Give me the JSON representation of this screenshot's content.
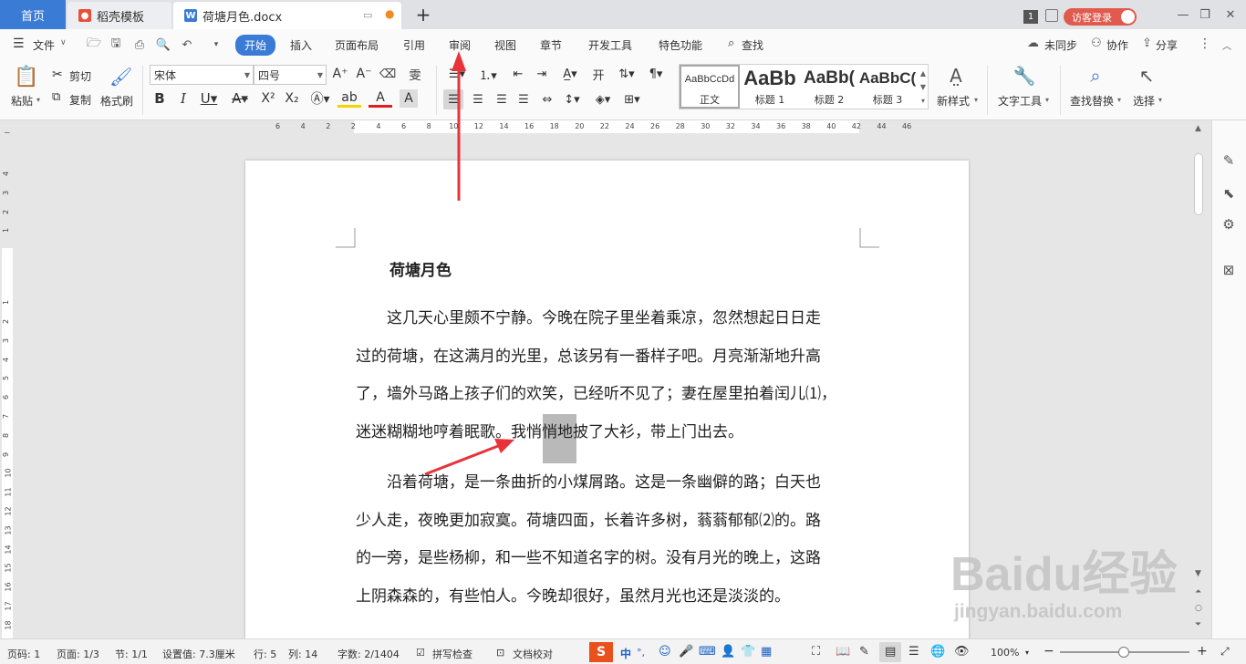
{
  "tabs": {
    "home": "首页",
    "template": "稻壳模板",
    "document": "荷塘月色.docx",
    "doc_icon": "W",
    "new_tab": "+"
  },
  "window": {
    "badge": "1",
    "login": "访客登录"
  },
  "menu": {
    "file": "文件",
    "items": [
      "开始",
      "插入",
      "页面布局",
      "引用",
      "审阅",
      "视图",
      "章节",
      "开发工具",
      "特色功能"
    ],
    "search": "查找",
    "sync": "未同步",
    "collab": "协作",
    "share": "分享"
  },
  "ribbon": {
    "paste": "粘贴",
    "cut": "剪切",
    "copy": "复制",
    "format_painter": "格式刷",
    "font_name": "宋体",
    "font_size": "四号",
    "styles": [
      {
        "sample": "AaBbCcDd",
        "name": "正文"
      },
      {
        "sample": "AaBb",
        "name": "标题 1"
      },
      {
        "sample": "AaBb(",
        "name": "标题 2"
      },
      {
        "sample": "AaBbC(",
        "name": "标题 3"
      }
    ],
    "new_style": "新样式",
    "text_tools": "文字工具",
    "find_replace": "查找替换",
    "select": "选择"
  },
  "ruler": {
    "h_marks": [
      "6",
      "4",
      "2",
      "2",
      "4",
      "6",
      "8",
      "10",
      "12",
      "14",
      "16",
      "18",
      "20",
      "22",
      "24",
      "26",
      "28",
      "30",
      "32",
      "34",
      "36",
      "38",
      "40",
      "42",
      "44",
      "46"
    ],
    "v_marks": [
      "4",
      "3",
      "2",
      "1",
      "1",
      "2",
      "3",
      "4",
      "5",
      "6",
      "7",
      "8",
      "9",
      "10",
      "11",
      "12",
      "13",
      "14",
      "15",
      "16",
      "17",
      "18",
      "19",
      "20"
    ]
  },
  "document": {
    "title": "荷塘月色",
    "paragraphs": [
      [
        "　　这几天心里颇不宁静。今晚在院子里坐着乘凉，忽然想起日日走",
        "过的荷塘，在这满月的光里，总该另有一番样子吧。月亮渐渐地升高",
        "了，墙外马路上孩子们的欢笑，已经听不见了；妻在屋里拍着闰儿⑴，",
        "迷迷糊糊地哼着眠歌。我悄悄地披了大衫，带上门出去。"
      ],
      [
        "　　沿着荷塘，是一条曲折的小煤屑路。这是一条幽僻的路；白天也",
        "少人走，夜晚更加寂寞。荷塘四面，长着许多树，蓊蓊郁郁⑵的。路",
        "的一旁，是些杨柳，和一些不知道名字的树。没有月光的晚上，这路",
        "上阴森森的，有些怕人。今晚却很好，虽然月光也还是淡淡的。"
      ]
    ]
  },
  "status": {
    "page_no": "页码: 1",
    "page": "页面: 1/3",
    "section": "节: 1/1",
    "setting": "设置值: 7.3厘米",
    "row": "行: 5",
    "col": "列: 14",
    "words": "字数: 2/1404",
    "spell": "拼写检查",
    "proof": "文档校对",
    "zoom": "100%",
    "ime": "中"
  },
  "watermark": {
    "brand": "Baidu经验",
    "url": "jingyan.baidu.com"
  },
  "colors": {
    "accent": "#3a7bd5",
    "annotation": "#e8333a",
    "login": "#e05a4e"
  }
}
